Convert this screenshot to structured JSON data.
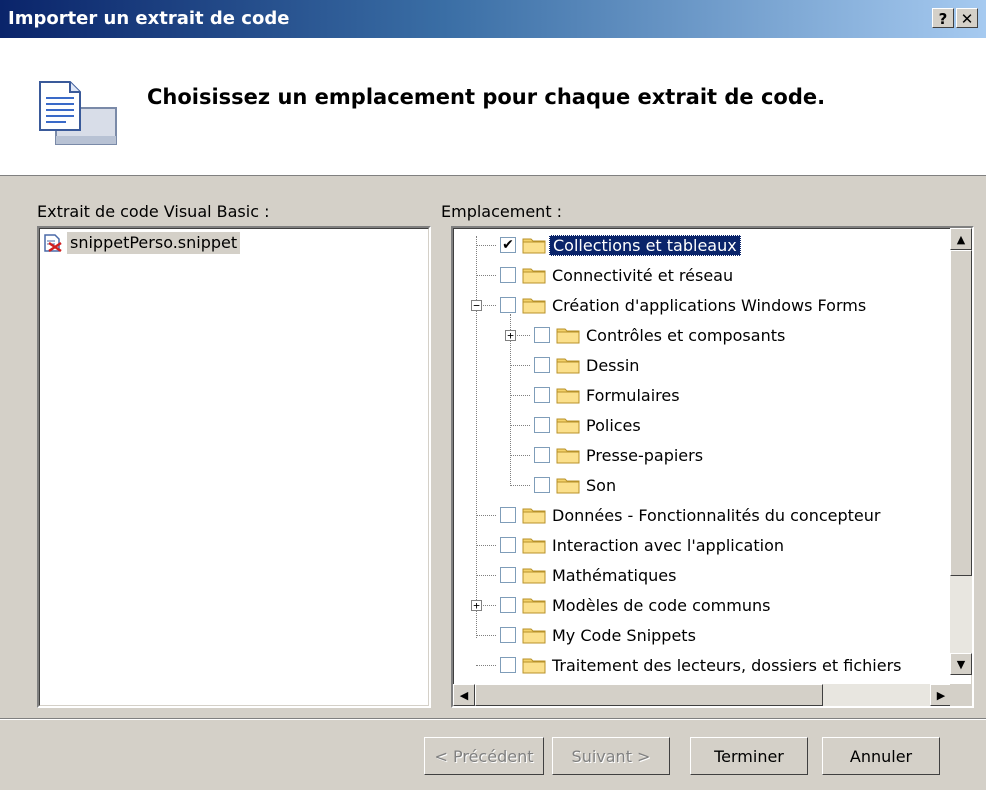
{
  "window": {
    "title": "Importer un extrait de code",
    "help_label": "?",
    "close_label": "✕"
  },
  "header": {
    "title": "Choisissez un emplacement pour chaque extrait de code.",
    "icon": "snippet-document-icon"
  },
  "left": {
    "label": "Extrait de code Visual Basic :",
    "items": [
      {
        "name": "snippetPerso.snippet",
        "icon": "snippet-file-icon"
      }
    ]
  },
  "right": {
    "label": "Emplacement :",
    "tree": [
      {
        "label": "Collections et tableaux",
        "checked": true,
        "selected": true
      },
      {
        "label": "Connectivité et réseau"
      },
      {
        "label": "Création d'applications Windows Forms",
        "expanded": true
      },
      {
        "label": "Contrôles et composants",
        "collapsed": true
      },
      {
        "label": "Dessin"
      },
      {
        "label": "Formulaires"
      },
      {
        "label": "Polices"
      },
      {
        "label": "Presse-papiers"
      },
      {
        "label": "Son"
      },
      {
        "label": "Données - Fonctionnalités du concepteur"
      },
      {
        "label": "Interaction avec l'application"
      },
      {
        "label": "Mathématiques"
      },
      {
        "label": "Modèles de code communs",
        "collapsed": true
      },
      {
        "label": "My Code Snippets"
      },
      {
        "label": "Traitement des lecteurs, dossiers et fichiers"
      }
    ]
  },
  "buttons": {
    "previous": "< Précédent",
    "next": "Suivant >",
    "finish": "Terminer",
    "cancel": "Annuler"
  }
}
